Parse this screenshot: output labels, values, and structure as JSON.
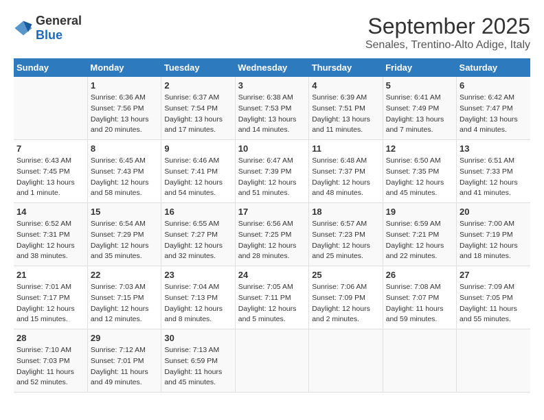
{
  "logo": {
    "general": "General",
    "blue": "Blue"
  },
  "title": "September 2025",
  "subtitle": "Senales, Trentino-Alto Adige, Italy",
  "days": [
    "Sunday",
    "Monday",
    "Tuesday",
    "Wednesday",
    "Thursday",
    "Friday",
    "Saturday"
  ],
  "weeks": [
    [
      {
        "day": "",
        "sunrise": "",
        "sunset": "",
        "daylight": ""
      },
      {
        "day": "1",
        "sunrise": "Sunrise: 6:36 AM",
        "sunset": "Sunset: 7:56 PM",
        "daylight": "Daylight: 13 hours and 20 minutes."
      },
      {
        "day": "2",
        "sunrise": "Sunrise: 6:37 AM",
        "sunset": "Sunset: 7:54 PM",
        "daylight": "Daylight: 13 hours and 17 minutes."
      },
      {
        "day": "3",
        "sunrise": "Sunrise: 6:38 AM",
        "sunset": "Sunset: 7:53 PM",
        "daylight": "Daylight: 13 hours and 14 minutes."
      },
      {
        "day": "4",
        "sunrise": "Sunrise: 6:39 AM",
        "sunset": "Sunset: 7:51 PM",
        "daylight": "Daylight: 13 hours and 11 minutes."
      },
      {
        "day": "5",
        "sunrise": "Sunrise: 6:41 AM",
        "sunset": "Sunset: 7:49 PM",
        "daylight": "Daylight: 13 hours and 7 minutes."
      },
      {
        "day": "6",
        "sunrise": "Sunrise: 6:42 AM",
        "sunset": "Sunset: 7:47 PM",
        "daylight": "Daylight: 13 hours and 4 minutes."
      }
    ],
    [
      {
        "day": "7",
        "sunrise": "Sunrise: 6:43 AM",
        "sunset": "Sunset: 7:45 PM",
        "daylight": "Daylight: 13 hours and 1 minute."
      },
      {
        "day": "8",
        "sunrise": "Sunrise: 6:45 AM",
        "sunset": "Sunset: 7:43 PM",
        "daylight": "Daylight: 12 hours and 58 minutes."
      },
      {
        "day": "9",
        "sunrise": "Sunrise: 6:46 AM",
        "sunset": "Sunset: 7:41 PM",
        "daylight": "Daylight: 12 hours and 54 minutes."
      },
      {
        "day": "10",
        "sunrise": "Sunrise: 6:47 AM",
        "sunset": "Sunset: 7:39 PM",
        "daylight": "Daylight: 12 hours and 51 minutes."
      },
      {
        "day": "11",
        "sunrise": "Sunrise: 6:48 AM",
        "sunset": "Sunset: 7:37 PM",
        "daylight": "Daylight: 12 hours and 48 minutes."
      },
      {
        "day": "12",
        "sunrise": "Sunrise: 6:50 AM",
        "sunset": "Sunset: 7:35 PM",
        "daylight": "Daylight: 12 hours and 45 minutes."
      },
      {
        "day": "13",
        "sunrise": "Sunrise: 6:51 AM",
        "sunset": "Sunset: 7:33 PM",
        "daylight": "Daylight: 12 hours and 41 minutes."
      }
    ],
    [
      {
        "day": "14",
        "sunrise": "Sunrise: 6:52 AM",
        "sunset": "Sunset: 7:31 PM",
        "daylight": "Daylight: 12 hours and 38 minutes."
      },
      {
        "day": "15",
        "sunrise": "Sunrise: 6:54 AM",
        "sunset": "Sunset: 7:29 PM",
        "daylight": "Daylight: 12 hours and 35 minutes."
      },
      {
        "day": "16",
        "sunrise": "Sunrise: 6:55 AM",
        "sunset": "Sunset: 7:27 PM",
        "daylight": "Daylight: 12 hours and 32 minutes."
      },
      {
        "day": "17",
        "sunrise": "Sunrise: 6:56 AM",
        "sunset": "Sunset: 7:25 PM",
        "daylight": "Daylight: 12 hours and 28 minutes."
      },
      {
        "day": "18",
        "sunrise": "Sunrise: 6:57 AM",
        "sunset": "Sunset: 7:23 PM",
        "daylight": "Daylight: 12 hours and 25 minutes."
      },
      {
        "day": "19",
        "sunrise": "Sunrise: 6:59 AM",
        "sunset": "Sunset: 7:21 PM",
        "daylight": "Daylight: 12 hours and 22 minutes."
      },
      {
        "day": "20",
        "sunrise": "Sunrise: 7:00 AM",
        "sunset": "Sunset: 7:19 PM",
        "daylight": "Daylight: 12 hours and 18 minutes."
      }
    ],
    [
      {
        "day": "21",
        "sunrise": "Sunrise: 7:01 AM",
        "sunset": "Sunset: 7:17 PM",
        "daylight": "Daylight: 12 hours and 15 minutes."
      },
      {
        "day": "22",
        "sunrise": "Sunrise: 7:03 AM",
        "sunset": "Sunset: 7:15 PM",
        "daylight": "Daylight: 12 hours and 12 minutes."
      },
      {
        "day": "23",
        "sunrise": "Sunrise: 7:04 AM",
        "sunset": "Sunset: 7:13 PM",
        "daylight": "Daylight: 12 hours and 8 minutes."
      },
      {
        "day": "24",
        "sunrise": "Sunrise: 7:05 AM",
        "sunset": "Sunset: 7:11 PM",
        "daylight": "Daylight: 12 hours and 5 minutes."
      },
      {
        "day": "25",
        "sunrise": "Sunrise: 7:06 AM",
        "sunset": "Sunset: 7:09 PM",
        "daylight": "Daylight: 12 hours and 2 minutes."
      },
      {
        "day": "26",
        "sunrise": "Sunrise: 7:08 AM",
        "sunset": "Sunset: 7:07 PM",
        "daylight": "Daylight: 11 hours and 59 minutes."
      },
      {
        "day": "27",
        "sunrise": "Sunrise: 7:09 AM",
        "sunset": "Sunset: 7:05 PM",
        "daylight": "Daylight: 11 hours and 55 minutes."
      }
    ],
    [
      {
        "day": "28",
        "sunrise": "Sunrise: 7:10 AM",
        "sunset": "Sunset: 7:03 PM",
        "daylight": "Daylight: 11 hours and 52 minutes."
      },
      {
        "day": "29",
        "sunrise": "Sunrise: 7:12 AM",
        "sunset": "Sunset: 7:01 PM",
        "daylight": "Daylight: 11 hours and 49 minutes."
      },
      {
        "day": "30",
        "sunrise": "Sunrise: 7:13 AM",
        "sunset": "Sunset: 6:59 PM",
        "daylight": "Daylight: 11 hours and 45 minutes."
      },
      {
        "day": "",
        "sunrise": "",
        "sunset": "",
        "daylight": ""
      },
      {
        "day": "",
        "sunrise": "",
        "sunset": "",
        "daylight": ""
      },
      {
        "day": "",
        "sunrise": "",
        "sunset": "",
        "daylight": ""
      },
      {
        "day": "",
        "sunrise": "",
        "sunset": "",
        "daylight": ""
      }
    ]
  ]
}
